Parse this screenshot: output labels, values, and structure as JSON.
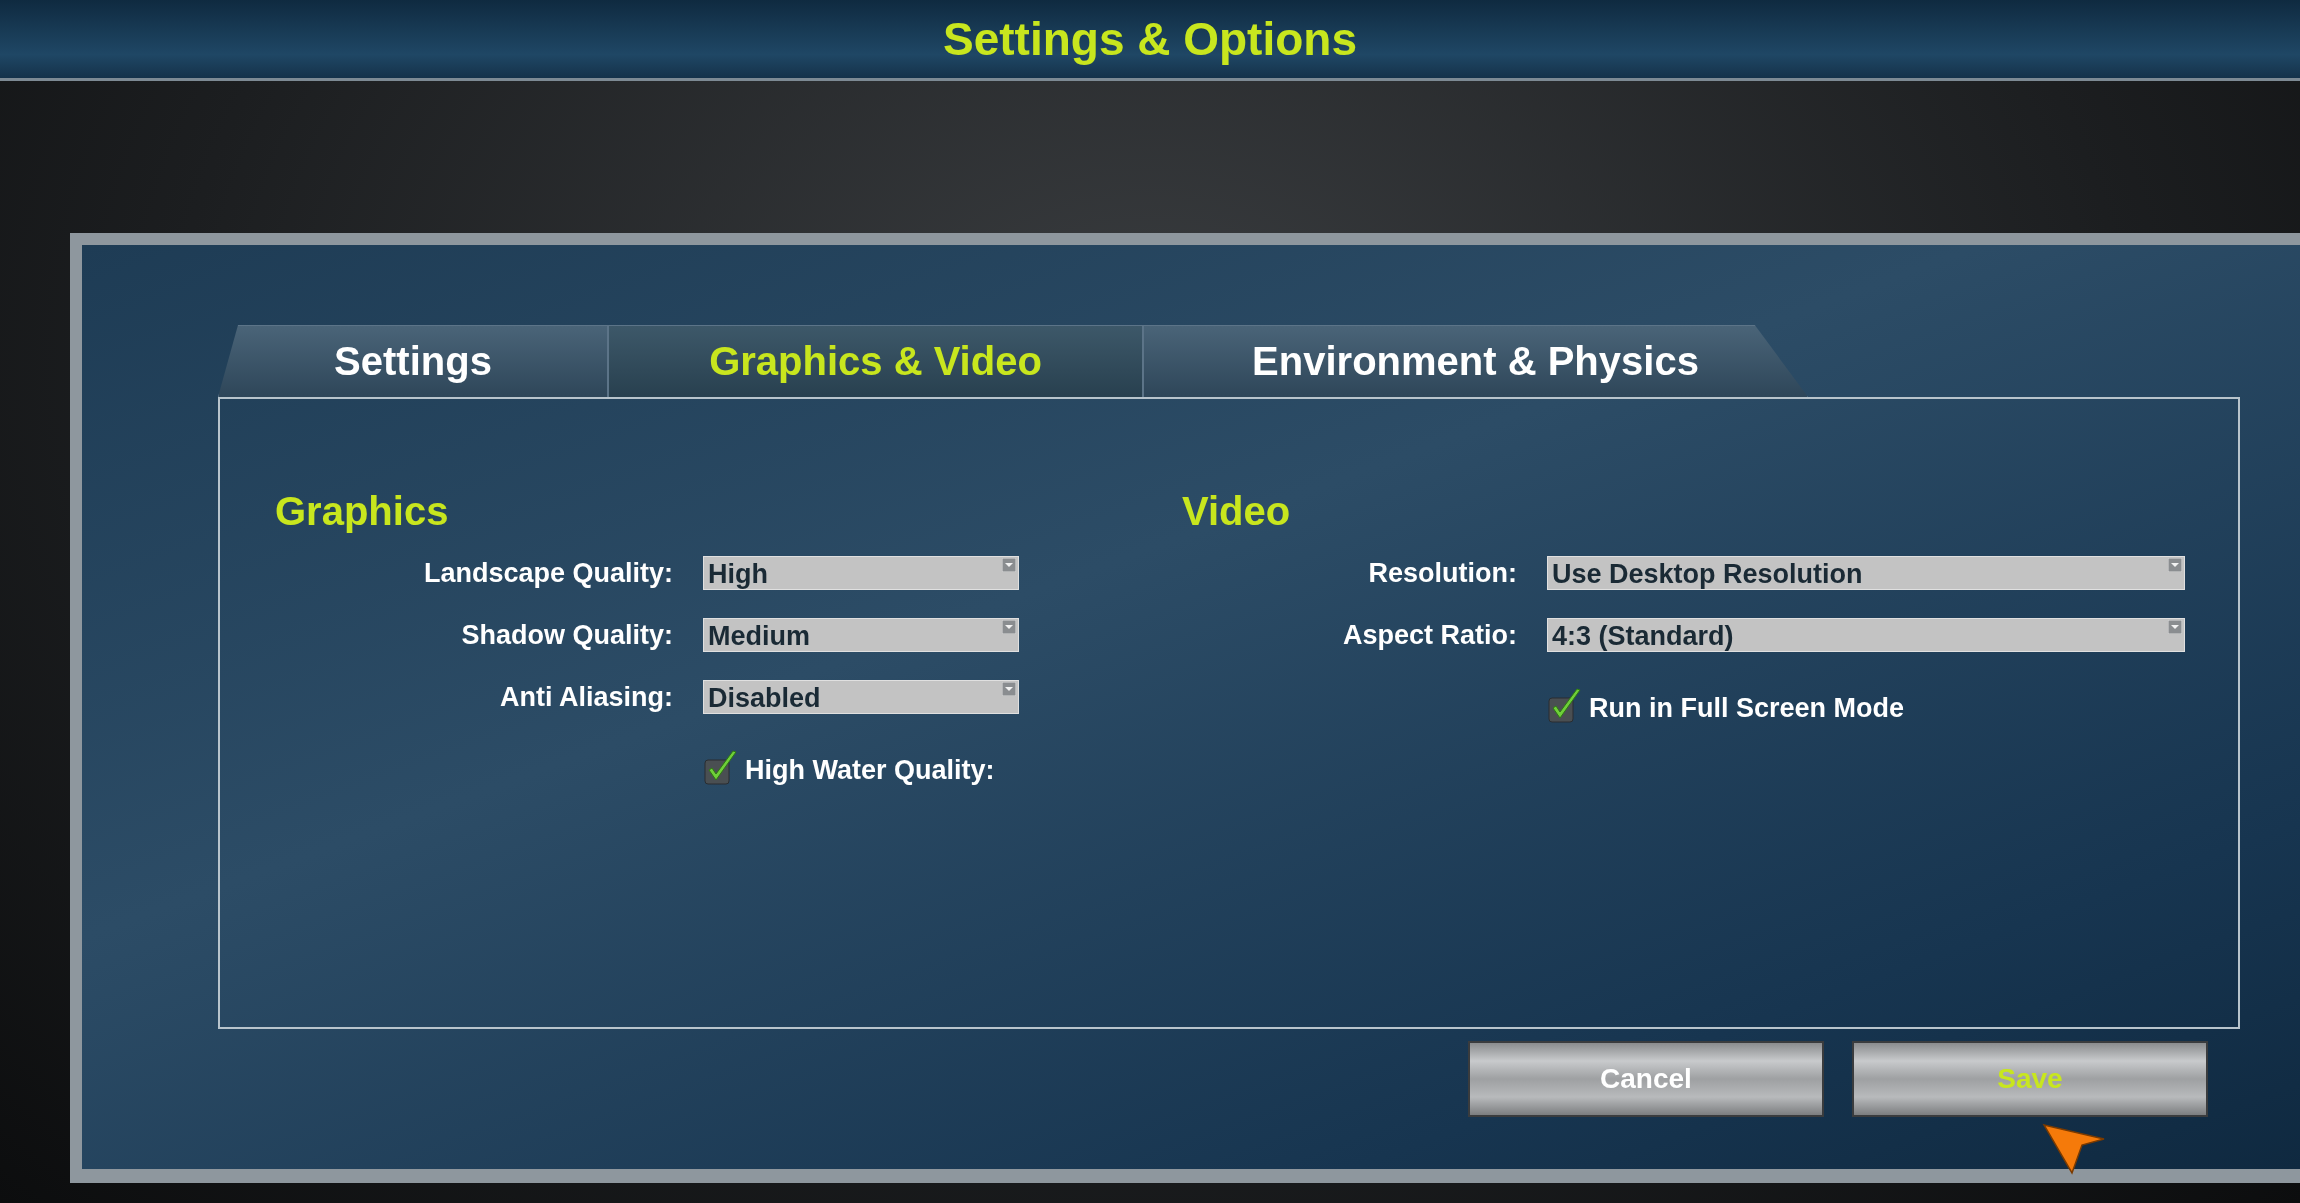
{
  "title": "Settings & Options",
  "tabs": [
    {
      "label": "Settings",
      "selected": false
    },
    {
      "label": "Graphics & Video",
      "selected": true
    },
    {
      "label": "Environment & Physics",
      "selected": false
    }
  ],
  "sections": [
    {
      "heading": "Graphics",
      "rows": [
        {
          "kind": "dropdown",
          "label": "Landscape Quality:",
          "value": "High"
        },
        {
          "kind": "dropdown",
          "label": "Shadow Quality:",
          "value": "Medium"
        },
        {
          "kind": "dropdown",
          "label": "Anti Aliasing:",
          "value": "Disabled"
        },
        {
          "kind": "checkbox",
          "label": "High Water Quality:",
          "checked": true
        }
      ]
    },
    {
      "heading": "Video",
      "rows": [
        {
          "kind": "dropdown",
          "label": "Resolution:",
          "value": "Use Desktop Resolution"
        },
        {
          "kind": "dropdown",
          "label": "Aspect Ratio:",
          "value": "4:3 (Standard)"
        },
        {
          "kind": "checkbox",
          "label": "Run in Full Screen Mode",
          "checked": true
        }
      ]
    }
  ],
  "buttons": [
    {
      "label": "Cancel",
      "highlighted": false
    },
    {
      "label": "Save",
      "highlighted": true
    }
  ]
}
